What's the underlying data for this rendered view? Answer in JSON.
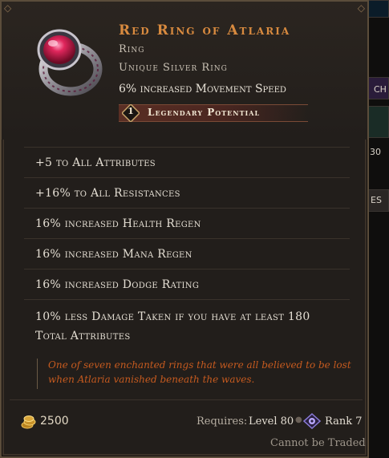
{
  "item": {
    "name": "Red Ring of Atlaria",
    "type": "Ring",
    "base": "Unique Silver Ring",
    "implicit": "6% increased Movement Speed",
    "legendary_potential_value": "1",
    "legendary_potential_label": "Legendary Potential"
  },
  "affixes": [
    "+5 to All Attributes",
    "+16% to All Resistances",
    "16% increased Health Regen",
    "16% increased Mana Regen",
    "16% increased Dodge Rating",
    "10% less Damage Taken if you have at least 180",
    "Total Attributes"
  ],
  "lore": "One of seven enchanted rings that were all believed to be lost when Atlaria vanished beneath the waves.",
  "footer": {
    "price": "2500",
    "requires_label": "Requires:",
    "requires_level": "Level 80",
    "rank": "Rank 7",
    "trade_status": "Cannot be Traded"
  },
  "background_labels": {
    "a": "CH",
    "b": "30",
    "c": "ES"
  },
  "colors": {
    "name_orange": "#d88a3f",
    "lore_orange": "#c55a1f",
    "potential_bar": "#5a2e24"
  },
  "icons": {
    "item": "red-ring-icon",
    "coin": "gold-coins-icon",
    "rank": "rank-eye-icon"
  }
}
